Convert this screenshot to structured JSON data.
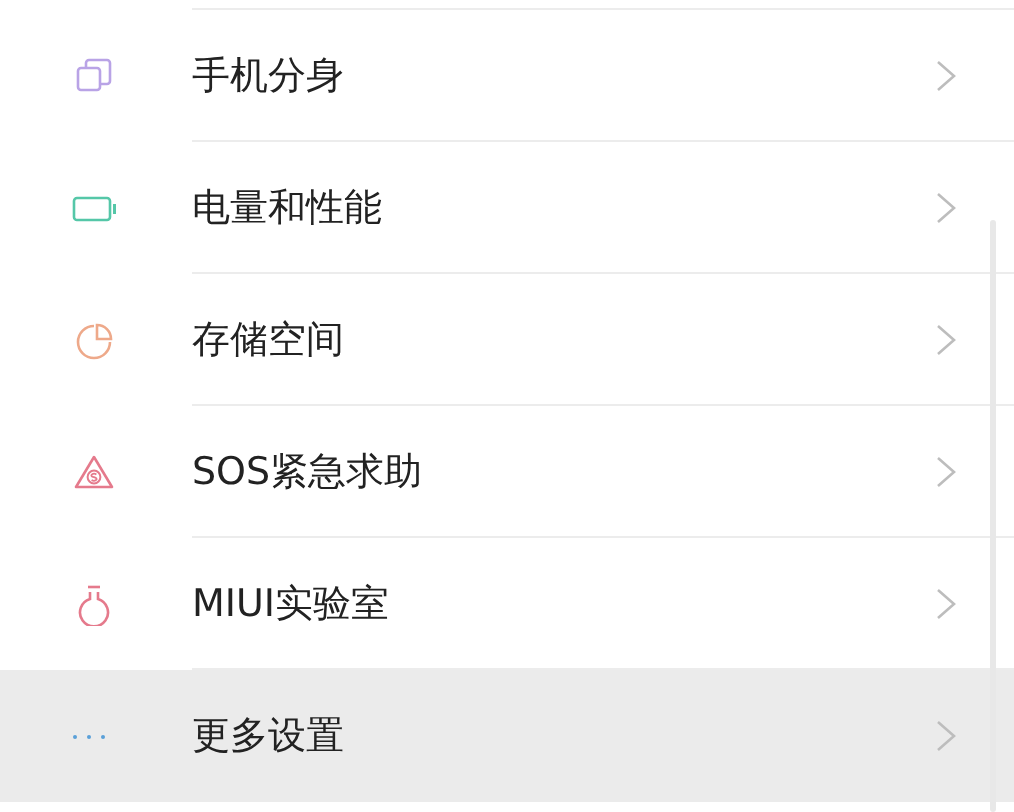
{
  "items": [
    {
      "kind": "clone",
      "label": "手机分身",
      "color": "#b9a3e6",
      "selected": false
    },
    {
      "kind": "battery",
      "label": "电量和性能",
      "color": "#55c7a8",
      "selected": false
    },
    {
      "kind": "storage",
      "label": "存储空间",
      "color": "#eea98a",
      "selected": false
    },
    {
      "kind": "sos",
      "label": "SOS紧急求助",
      "color": "#e57a8c",
      "selected": false
    },
    {
      "kind": "lab",
      "label": "MIUI实验室",
      "color": "#e57a8c",
      "selected": false
    },
    {
      "kind": "more",
      "label": "更多设置",
      "color": "#5aa0d8",
      "selected": true
    }
  ]
}
